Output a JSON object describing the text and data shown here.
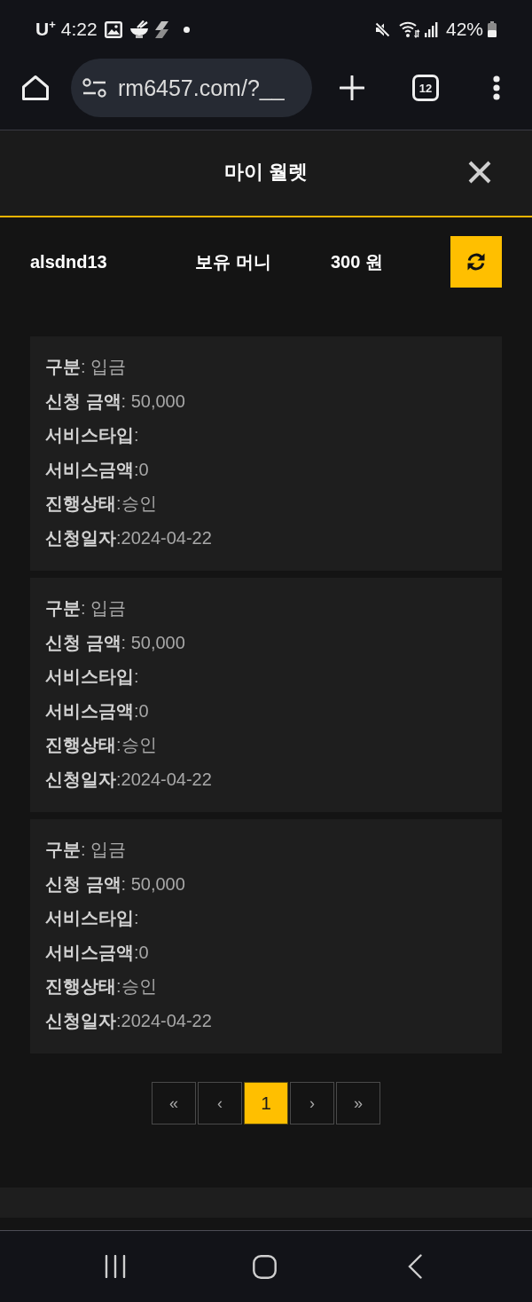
{
  "status_bar": {
    "carrier": "U$^{+}$",
    "time": "4:22",
    "battery": "42%"
  },
  "browser": {
    "url": "rm6457.com/?__",
    "tab_count": "12"
  },
  "modal": {
    "title": "마이 월렛"
  },
  "wallet": {
    "username": "alsdnd13",
    "balance_label": "보유 머니",
    "balance": "300 원"
  },
  "transactions": [
    {
      "lines": [
        "**구분**: 입금",
        "**신청 금액**: 50,000",
        "**서비스타입**:",
        "**서비스금액**:0",
        "**진행상태**:승인",
        "**신청일자**:2024-04-22"
      ]
    },
    {
      "lines": [
        "**구분**: 입금",
        "**신청 금액**: 50,000",
        "**서비스타입**:",
        "**서비스금액**:0",
        "**진행상태**:승인",
        "**신청일자**:2024-04-22"
      ]
    },
    {
      "lines": [
        "**구분**: 입금",
        "**신청 금액**: 50,000",
        "**서비스타입**:",
        "**서비스금액**:0",
        "**진행상태**:승인",
        "**신청일자**:2024-04-22"
      ]
    }
  ],
  "pagination": [
    {
      "label": "«",
      "selected": false
    },
    {
      "label": "‹",
      "selected": false
    },
    {
      "label": "1",
      "selected": true
    },
    {
      "label": "›",
      "selected": false
    },
    {
      "label": "»",
      "selected": false
    }
  ]
}
